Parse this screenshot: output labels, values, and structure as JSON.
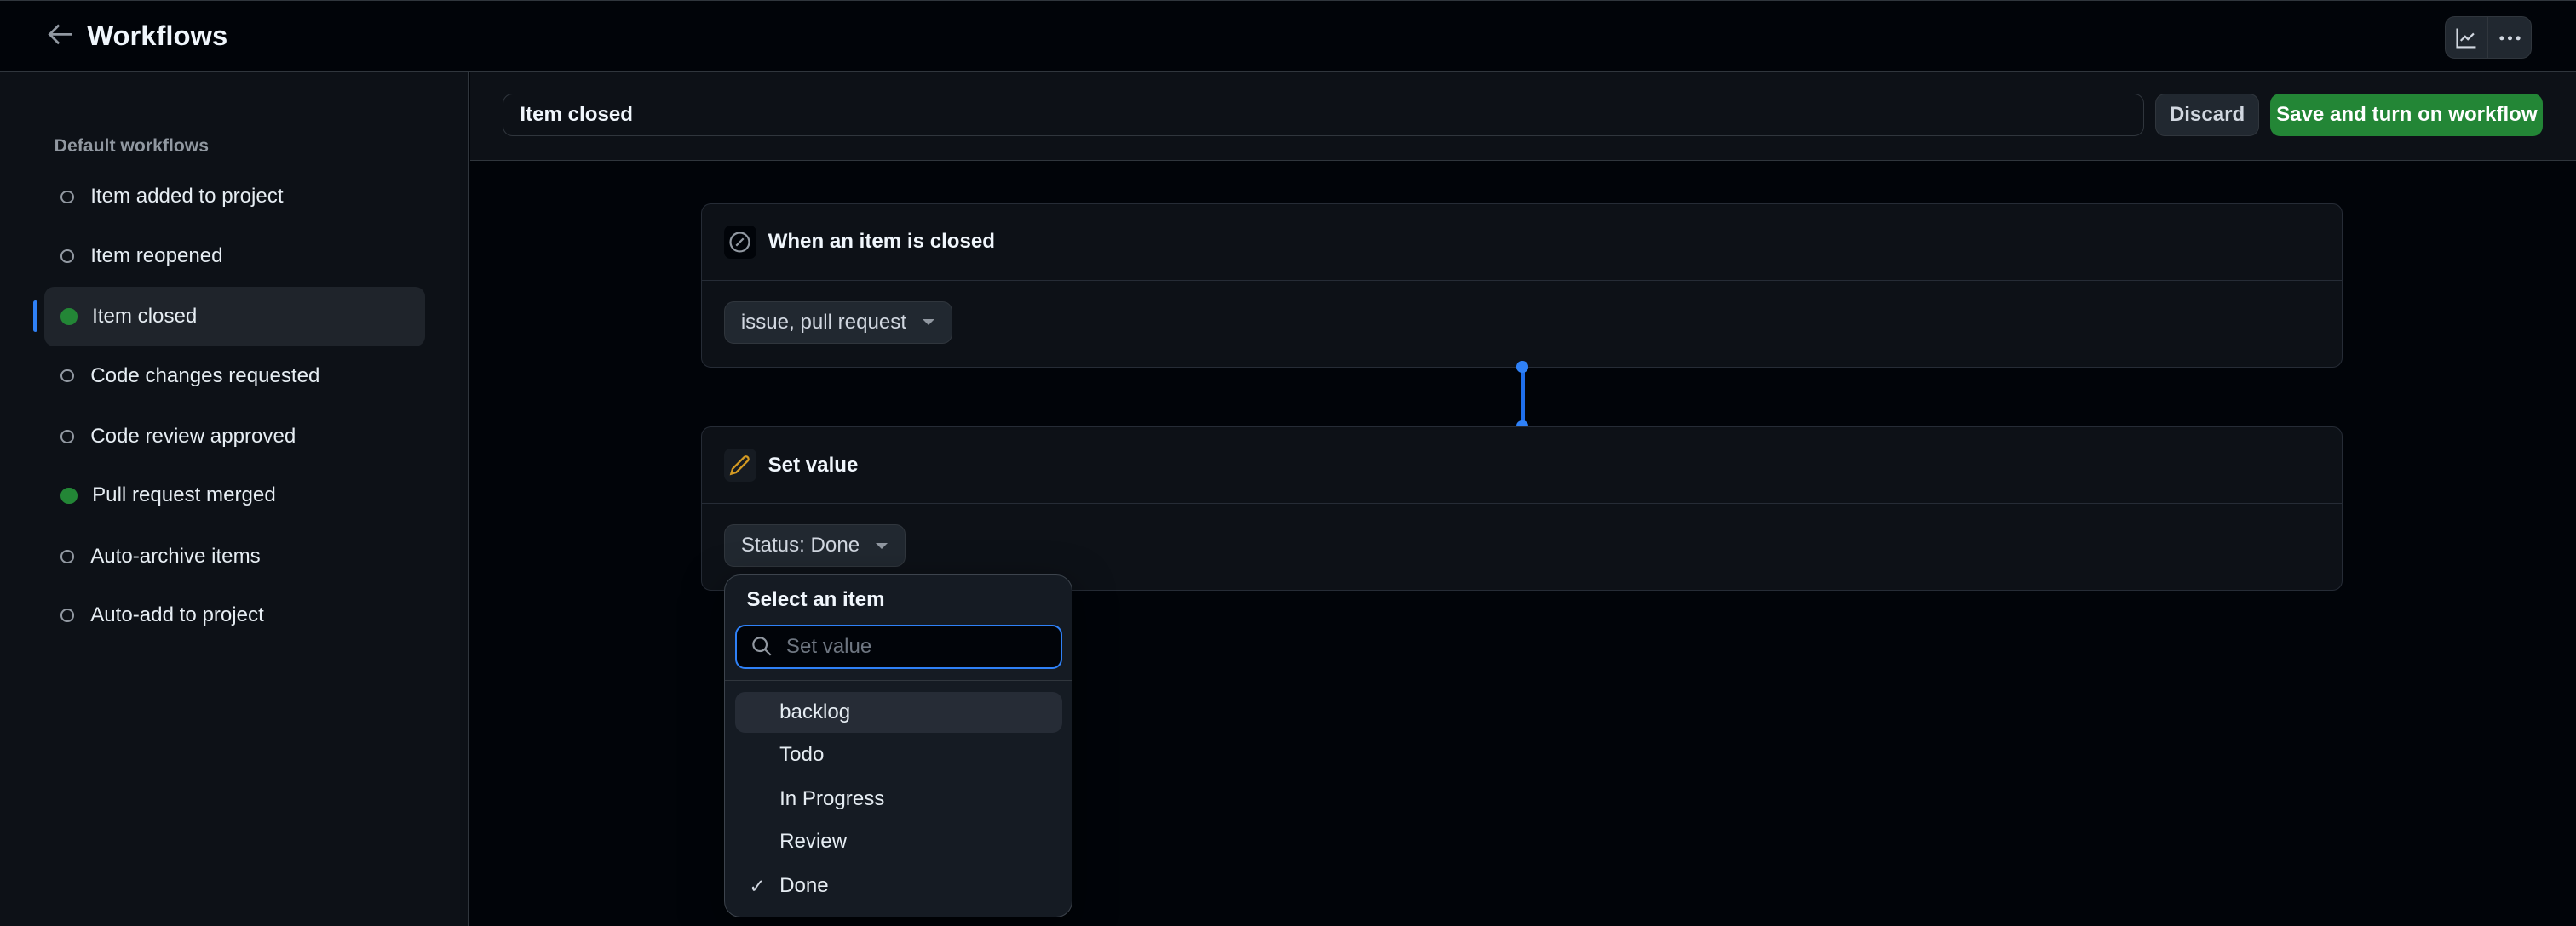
{
  "header": {
    "title": "Workflows",
    "back_icon": "arrow-left-icon",
    "insights_icon": "graph-icon",
    "more_icon": "kebab-horizontal-icon"
  },
  "sidebar": {
    "section_label": "Default workflows",
    "items": [
      {
        "label": "Item added to project",
        "enabled": false
      },
      {
        "label": "Item reopened",
        "enabled": false
      },
      {
        "label": "Item closed",
        "enabled": true,
        "selected": true
      },
      {
        "label": "Code changes requested",
        "enabled": false
      },
      {
        "label": "Code review approved",
        "enabled": false
      },
      {
        "label": "Pull request merged",
        "enabled": true
      },
      {
        "label": "Auto-archive items",
        "enabled": false
      },
      {
        "label": "Auto-add to project",
        "enabled": false
      }
    ]
  },
  "editor": {
    "workflow_name": "Item closed",
    "discard_label": "Discard",
    "save_label": "Save and turn on workflow"
  },
  "trigger": {
    "title": "When an item is closed",
    "icon": "skip-icon",
    "filter_value": "issue, pull request"
  },
  "action": {
    "title": "Set value",
    "icon": "pencil-icon",
    "value": "Status: Done"
  },
  "menu": {
    "title": "Select an item",
    "search_placeholder": "Set value",
    "search_value": "",
    "options": [
      {
        "label": "backlog",
        "highlighted": true,
        "checked": false
      },
      {
        "label": "Todo",
        "checked": false
      },
      {
        "label": "In Progress",
        "checked": false
      },
      {
        "label": "Review",
        "checked": false
      },
      {
        "label": "Done",
        "checked": true,
        "check": "✓"
      }
    ]
  },
  "colors": {
    "accent": "#2f81f7",
    "success": "#238636",
    "pencil": "#d29922"
  }
}
